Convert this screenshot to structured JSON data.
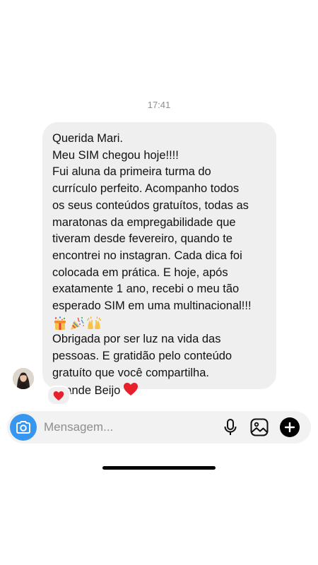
{
  "chat": {
    "timestamp": "17:41",
    "message": {
      "lines": [
        "Querida Mari.",
        "Meu SIM chegou hoje!!!!",
        "Fui aluna da primeira turma do",
        "currículo perfeito. Acompanho todos",
        "os seus conteúdos gratuítos, todas as",
        "maratonas da empregabilidade que",
        "tiveram desde fevereiro, quando te",
        "encontrei no instagran. Cada dica foi",
        "colocada em prática. E hoje, após",
        "exatamente 1 ano, recebi o meu tão",
        "esperado SIM em uma multinacional!!!"
      ],
      "emojis": [
        "party-popper",
        "party-horn",
        "raising-hands"
      ],
      "lines_after": [
        "Obrigada por ser luz na vida das",
        "pessoas. E gratidão pelo conteúdo",
        "gratuíto que você compartilha."
      ],
      "signoff": "Grande Beijo",
      "signoff_icon": "red-heart-emoji"
    },
    "reaction": {
      "icon": "red-heart-emoji"
    },
    "sender_avatar": {
      "icon": "avatar-photo"
    }
  },
  "composer": {
    "placeholder": "Mensagem...",
    "value": "",
    "camera_icon": "camera-icon",
    "mic_icon": "microphone-icon",
    "gallery_icon": "gallery-icon",
    "plus_icon": "plus-icon"
  },
  "colors": {
    "bubble_bg": "#efefef",
    "camera_bg": "#3797f0",
    "heart": "#e8202a",
    "timestamp": "#8e8e93"
  }
}
